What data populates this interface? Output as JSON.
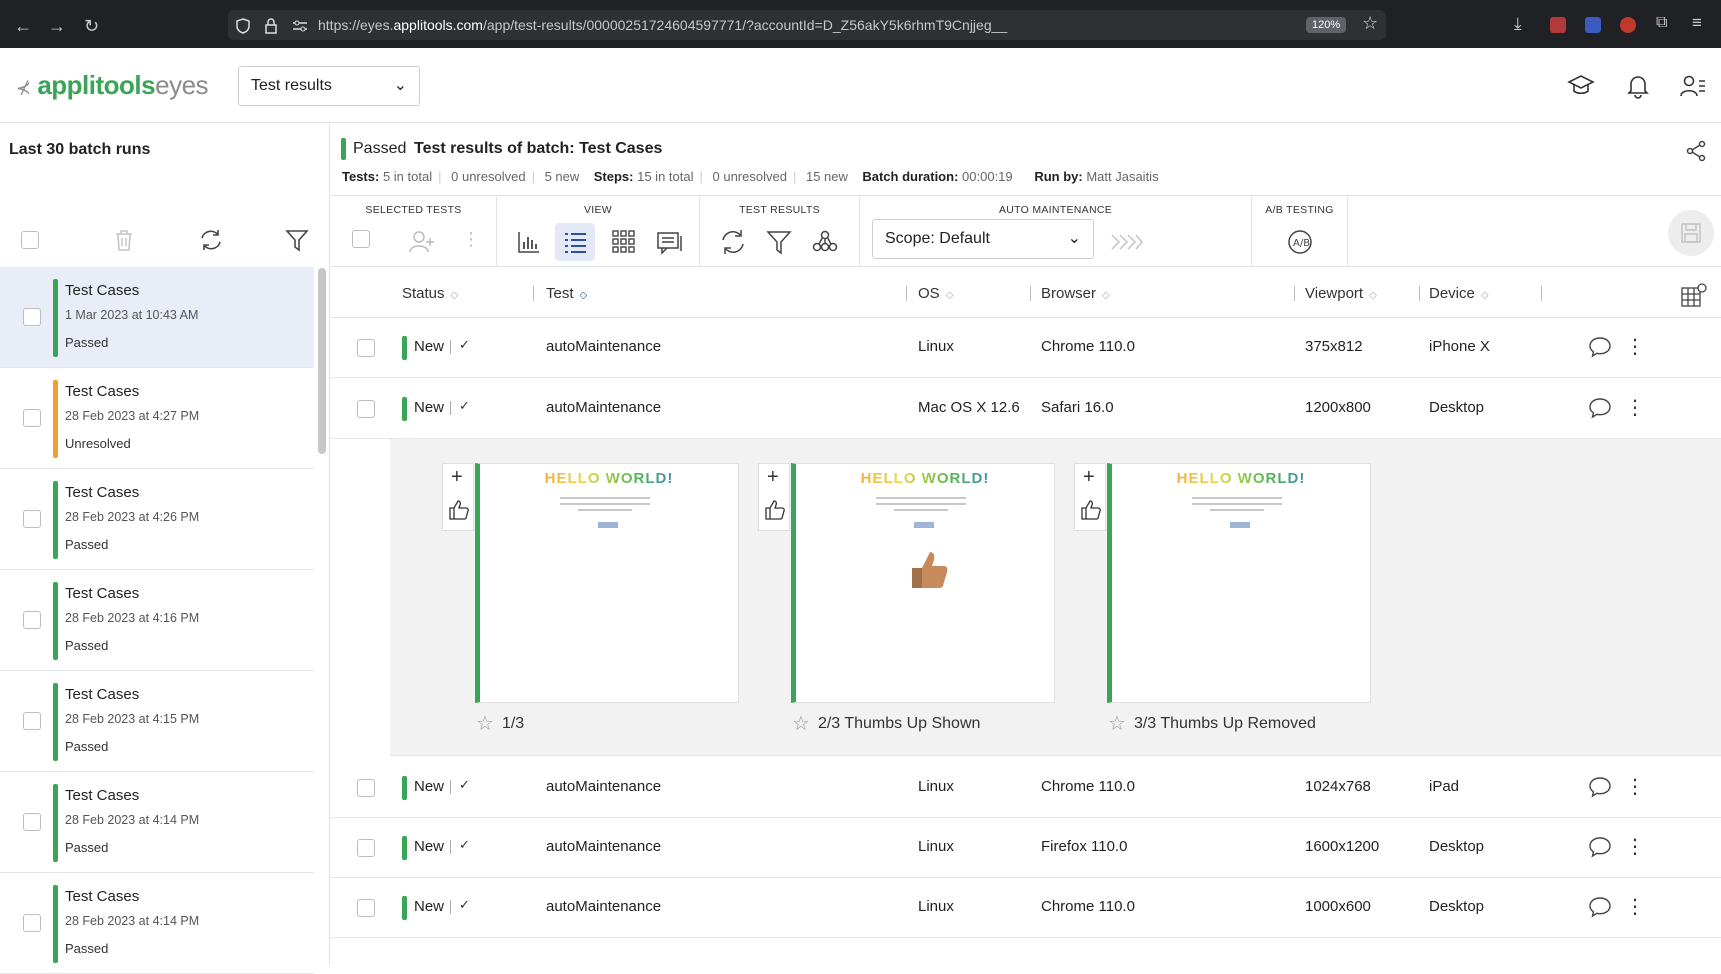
{
  "browser": {
    "url_prefix": "https://eyes.",
    "url_domain": "applitools.com",
    "url_path": "/app/test-results/00000251724604597771/?accountId=D_Z56akY5k6rhmT9Cnjjeg__",
    "zoom": "120%"
  },
  "app": {
    "logo_main": "applitools",
    "logo_sub": "eyes",
    "page_select": "Test results"
  },
  "sidebar": {
    "title": "Last 30 batch runs",
    "batches": [
      {
        "name": "Test Cases",
        "date": "1 Mar 2023 at 10:43 AM",
        "status": "Passed",
        "color": "#3aa556"
      },
      {
        "name": "Test Cases",
        "date": "28 Feb 2023 at 4:27 PM",
        "status": "Unresolved",
        "color": "#f0a030"
      },
      {
        "name": "Test Cases",
        "date": "28 Feb 2023 at 4:26 PM",
        "status": "Passed",
        "color": "#3aa556"
      },
      {
        "name": "Test Cases",
        "date": "28 Feb 2023 at 4:16 PM",
        "status": "Passed",
        "color": "#3aa556"
      },
      {
        "name": "Test Cases",
        "date": "28 Feb 2023 at 4:15 PM",
        "status": "Passed",
        "color": "#3aa556"
      },
      {
        "name": "Test Cases",
        "date": "28 Feb 2023 at 4:14 PM",
        "status": "Passed",
        "color": "#3aa556"
      },
      {
        "name": "Test Cases",
        "date": "28 Feb 2023 at 4:14 PM",
        "status": "Passed",
        "color": "#3aa556"
      }
    ]
  },
  "batch_header": {
    "status": "Passed",
    "title": "Test results of batch:  Test Cases",
    "tests_label": "Tests:",
    "tests_total": "5 in total",
    "tests_unresolved": "0 unresolved",
    "tests_new": "5 new",
    "steps_label": "Steps:",
    "steps_total": "15 in total",
    "steps_unresolved": "0 unresolved",
    "steps_new": "15 new",
    "duration_label": "Batch duration:",
    "duration": "00:00:19",
    "runby_label": "Run by:",
    "runby": "Matt Jasaitis"
  },
  "toolbar": {
    "selected_tests": "SELECTED TESTS",
    "view": "VIEW",
    "test_results": "TEST RESULTS",
    "auto_maintenance": "AUTO MAINTENANCE",
    "ab_testing": "A/B TESTING",
    "scope": "Scope: Default"
  },
  "table": {
    "columns": [
      "Status",
      "Test",
      "OS",
      "Browser",
      "Viewport",
      "Device"
    ],
    "rows": [
      {
        "status": "New",
        "test": "autoMaintenance",
        "os": "Linux",
        "browser": "Chrome 110.0",
        "viewport": "375x812",
        "device": "iPhone X"
      },
      {
        "status": "New",
        "test": "autoMaintenance",
        "os": "Mac OS X 12.6",
        "browser": "Safari 16.0",
        "viewport": "1200x800",
        "device": "Desktop"
      },
      {
        "status": "New",
        "test": "autoMaintenance",
        "os": "Linux",
        "browser": "Chrome 110.0",
        "viewport": "1024x768",
        "device": "iPad"
      },
      {
        "status": "New",
        "test": "autoMaintenance",
        "os": "Linux",
        "browser": "Firefox 110.0",
        "viewport": "1600x1200",
        "device": "Desktop"
      },
      {
        "status": "New",
        "test": "autoMaintenance",
        "os": "Linux",
        "browser": "Chrome 110.0",
        "viewport": "1000x600",
        "device": "Desktop"
      }
    ]
  },
  "steps": [
    {
      "caption": "1/3",
      "hello": "HELLO WORLD!"
    },
    {
      "caption": "2/3 Thumbs Up Shown",
      "hello": "HELLO WORLD!"
    },
    {
      "caption": "3/3 Thumbs Up Removed",
      "hello": "HELLO WORLD!"
    }
  ]
}
